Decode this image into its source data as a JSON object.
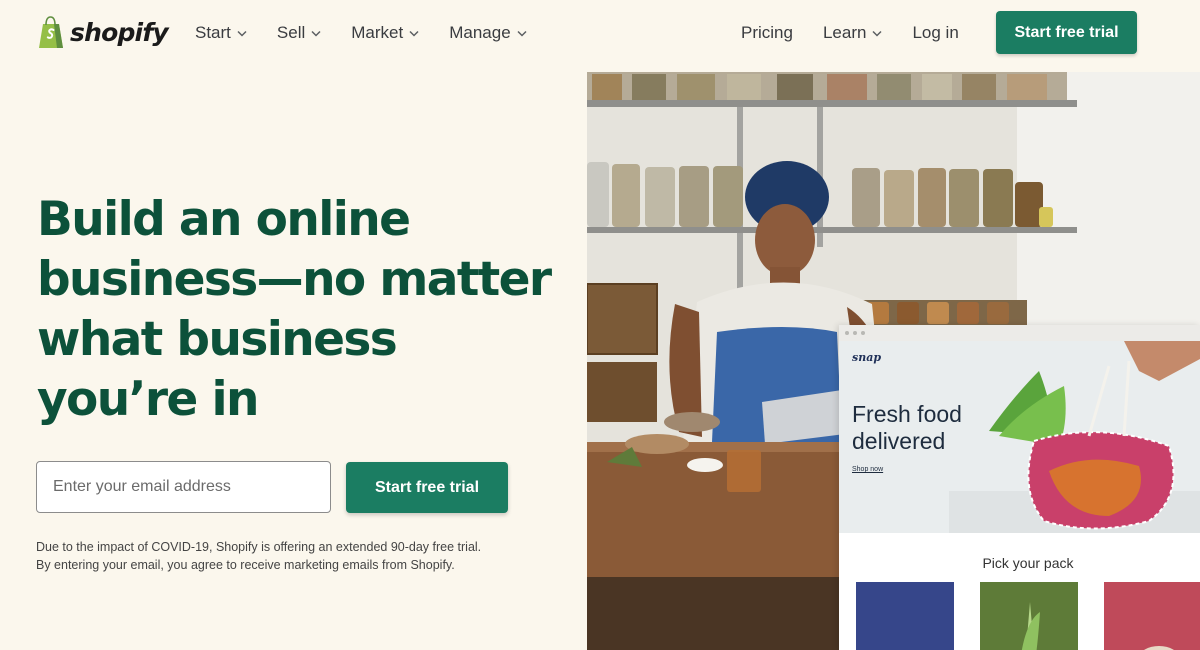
{
  "brand": {
    "name": "shopify",
    "accent_color": "#1b7d62",
    "heading_color": "#0c513a",
    "background_color": "#fbf7ed"
  },
  "nav": {
    "left": [
      {
        "label": "Start",
        "icon": "chevron-down-icon"
      },
      {
        "label": "Sell",
        "icon": "chevron-down-icon"
      },
      {
        "label": "Market",
        "icon": "chevron-down-icon"
      },
      {
        "label": "Manage",
        "icon": "chevron-down-icon"
      }
    ],
    "right": [
      {
        "label": "Pricing"
      },
      {
        "label": "Learn",
        "icon": "chevron-down-icon"
      },
      {
        "label": "Log in"
      }
    ],
    "cta_label": "Start free trial"
  },
  "hero": {
    "title": "Build an online business—no matter what business you’re in",
    "email_placeholder": "Enter your email address",
    "cta_label": "Start free trial",
    "disclaimer": "Due to the impact of COVID-19, Shopify is offering an extended 90-day free trial. By entering your email, you agree to receive marketing emails from Shopify."
  },
  "storefront": {
    "logo": "snap",
    "headline": "Fresh food delivered",
    "link_label": "Shop now",
    "section_title": "Pick your pack"
  }
}
